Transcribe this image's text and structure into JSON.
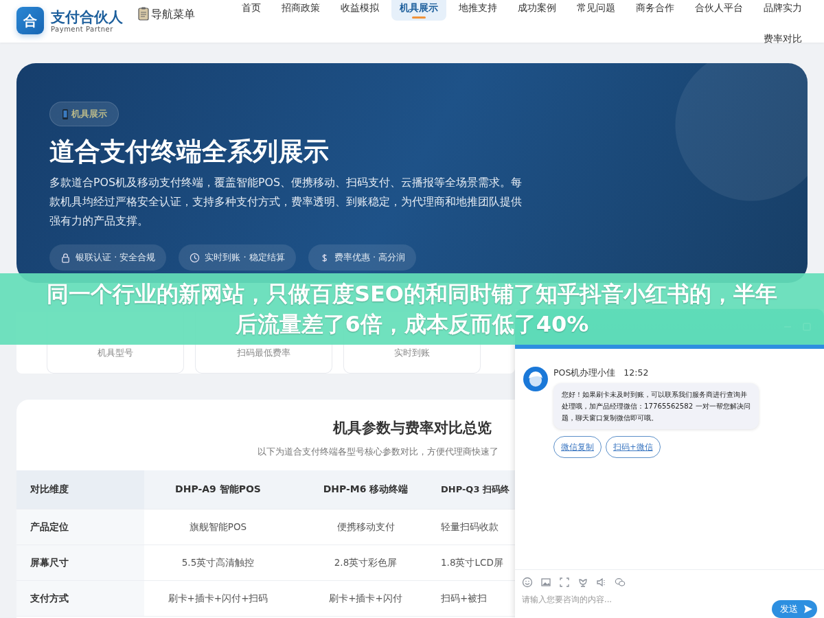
{
  "header": {
    "logo_mark": "合",
    "brand": "支付合伙人",
    "tagline": "Payment Partner",
    "menu_toggle": "导航菜单",
    "nav": [
      {
        "label": "首页",
        "selected": false
      },
      {
        "label": "招商政策",
        "selected": false
      },
      {
        "label": "收益模拟",
        "selected": false
      },
      {
        "label": "机具展示",
        "selected": true
      },
      {
        "label": "地推支持",
        "selected": false
      },
      {
        "label": "成功案例",
        "selected": false
      },
      {
        "label": "常见问题",
        "selected": false
      },
      {
        "label": "商务合作",
        "selected": false
      },
      {
        "label": "合伙人平台",
        "selected": false
      },
      {
        "label": "品牌实力",
        "selected": false
      },
      {
        "label": "费率对比",
        "selected": false
      }
    ]
  },
  "hero": {
    "badge": "机具展示",
    "title": "道合支付终端全系列展示",
    "description": "多款道合POS机及移动支付终端，覆盖智能POS、便携移动、扫码支付、云播报等全场景需求。每款机具均经过严格安全认证，支持多种支付方式，费率透明、到账稳定，为代理商和地推团队提供强有力的产品支撑。",
    "features": [
      {
        "kind": "lock",
        "label": "银联认证 · 安全合规"
      },
      {
        "kind": "clock",
        "label": "实时到账 · 稳定结算"
      },
      {
        "kind": "dollar",
        "label": "费率优惠 · 高分润"
      }
    ]
  },
  "stats": [
    {
      "label": "机具型号"
    },
    {
      "label": "扫码最低费率"
    },
    {
      "label": "实时到账"
    }
  ],
  "comparison": {
    "title": "机具参数与费率对比总览",
    "subtitle": "以下为道合支付终端各型号核心参数对比，方便代理商快速了",
    "columns": [
      "对比维度",
      "DHP-A9 智能POS",
      "DHP-M6 移动终端",
      "DHP-Q3 扫码终"
    ],
    "rows": [
      [
        "产品定位",
        "旗舰智能POS",
        "便携移动支付",
        "轻量扫码收款"
      ],
      [
        "屏幕尺寸",
        "5.5英寸高清触控",
        "2.8英寸彩色屏",
        "1.8英寸LCD屏"
      ],
      [
        "支付方式",
        "刷卡+插卡+闪付+扫码",
        "刷卡+插卡+闪付",
        "扫码+被扫"
      ]
    ]
  },
  "banner": {
    "text": "同一个行业的新网站，只做百度SEO的和同时铺了知乎抖音小红书的，半年后流量差了6倍，成本反而低了40%"
  },
  "chat": {
    "sender": "POS机办理小佳",
    "time": "12:52",
    "message": "您好！如果刷卡未及时到账，可以联系我们服务商进行查询并处理哦，加产品经理微信：17765562582 一对一帮您解决问题，聊天窗口复制微信即可哦。",
    "quick_replies": [
      "微信复制",
      "扫码+微信"
    ],
    "tools": [
      {
        "kind": "emoji"
      },
      {
        "kind": "image"
      },
      {
        "kind": "screenshot"
      },
      {
        "kind": "flower"
      },
      {
        "kind": "speaker"
      },
      {
        "kind": "wechat"
      }
    ],
    "placeholder": "请输入您要咨询的内容...",
    "send": "发送"
  }
}
